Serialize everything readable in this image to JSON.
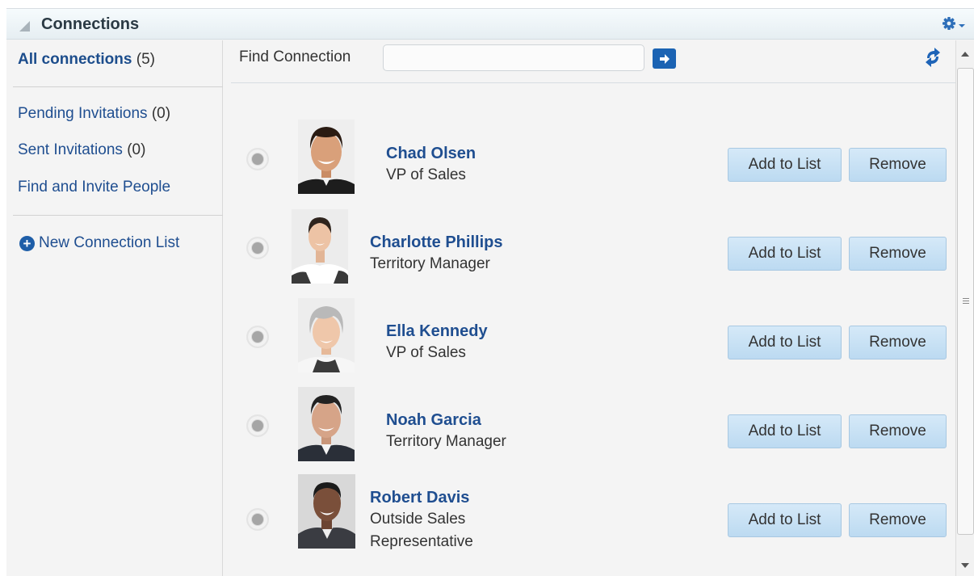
{
  "header": {
    "title": "Connections",
    "collapse_icon": "triangle-collapse-icon",
    "settings_icon": "gear-dropdown-icon"
  },
  "sidebar": {
    "all": {
      "label": "All connections",
      "count": "(5)"
    },
    "items": [
      {
        "label": "Pending Invitations",
        "count": "(0)"
      },
      {
        "label": "Sent Invitations",
        "count": "(0)"
      },
      {
        "label": "Find and Invite People",
        "count": ""
      }
    ],
    "new_list": {
      "label": "New Connection List",
      "icon": "plus-circle-icon"
    }
  },
  "search": {
    "label": "Find Connection",
    "value": "",
    "placeholder": "",
    "go_icon": "arrow-right-icon",
    "refresh_icon": "refresh-icon"
  },
  "connections": [
    {
      "name": "Chad Olsen",
      "title_lines": [
        "VP of Sales"
      ],
      "add_label": "Add to List",
      "remove_label": "Remove"
    },
    {
      "name": "Charlotte Phillips",
      "title_lines": [
        "Territory Manager"
      ],
      "add_label": "Add to List",
      "remove_label": "Remove"
    },
    {
      "name": "Ella Kennedy",
      "title_lines": [
        "VP of Sales"
      ],
      "add_label": "Add to List",
      "remove_label": "Remove"
    },
    {
      "name": "Noah Garcia",
      "title_lines": [
        "Territory Manager"
      ],
      "add_label": "Add to List",
      "remove_label": "Remove"
    },
    {
      "name": "Robert Davis",
      "title_lines": [
        "Outside Sales",
        "Representative"
      ],
      "add_label": "Add to List",
      "remove_label": "Remove"
    }
  ],
  "colors": {
    "link": "#1f4e90",
    "button_bg": "#c9e2f5",
    "accent": "#1b63b3"
  }
}
